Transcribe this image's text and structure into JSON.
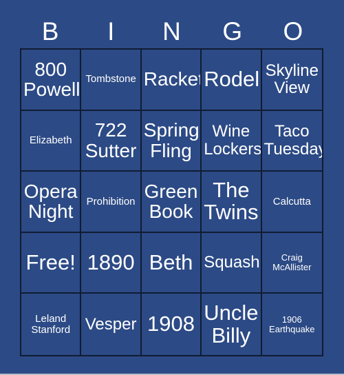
{
  "card": {
    "title": "BINGO",
    "header_letters": [
      "B",
      "I",
      "N",
      "G",
      "O"
    ],
    "colors": {
      "background": "#2c4a85",
      "cell_background": "#2c4a85",
      "grid_line": "#101c33",
      "text": "#ffffff",
      "bottom_strip": "#b9bcc9"
    },
    "columns": 5,
    "rows": 5,
    "free_space": "Free!",
    "cells": [
      [
        {
          "label": "800 Powell",
          "size": "lg"
        },
        {
          "label": "Tombstone",
          "size": "sm"
        },
        {
          "label": "Racket",
          "size": "lg"
        },
        {
          "label": "Rodel",
          "size": "xl"
        },
        {
          "label": "Skyline View",
          "size": "md"
        }
      ],
      [
        {
          "label": "Elizabeth",
          "size": "sm"
        },
        {
          "label": "722 Sutter",
          "size": "lg"
        },
        {
          "label": "Spring Fling",
          "size": "lg"
        },
        {
          "label": "Wine Lockers",
          "size": "md"
        },
        {
          "label": "Taco Tuesday",
          "size": "md"
        }
      ],
      [
        {
          "label": "Opera Night",
          "size": "lg"
        },
        {
          "label": "Prohibition",
          "size": "sm"
        },
        {
          "label": "Green Book",
          "size": "lg"
        },
        {
          "label": "The Twins",
          "size": "xl"
        },
        {
          "label": "Calcutta",
          "size": "sm"
        }
      ],
      [
        {
          "label": "Free!",
          "size": "xl"
        },
        {
          "label": "1890",
          "size": "xl"
        },
        {
          "label": "Beth",
          "size": "xl"
        },
        {
          "label": "Squash",
          "size": "md"
        },
        {
          "label": "Craig McAllister",
          "size": "xs"
        }
      ],
      [
        {
          "label": "Leland Stanford",
          "size": "sm"
        },
        {
          "label": "Vesper",
          "size": "md"
        },
        {
          "label": "1908",
          "size": "xl"
        },
        {
          "label": "Uncle Billy",
          "size": "xl"
        },
        {
          "label": "1906 Earthquake",
          "size": "xs"
        }
      ]
    ]
  }
}
